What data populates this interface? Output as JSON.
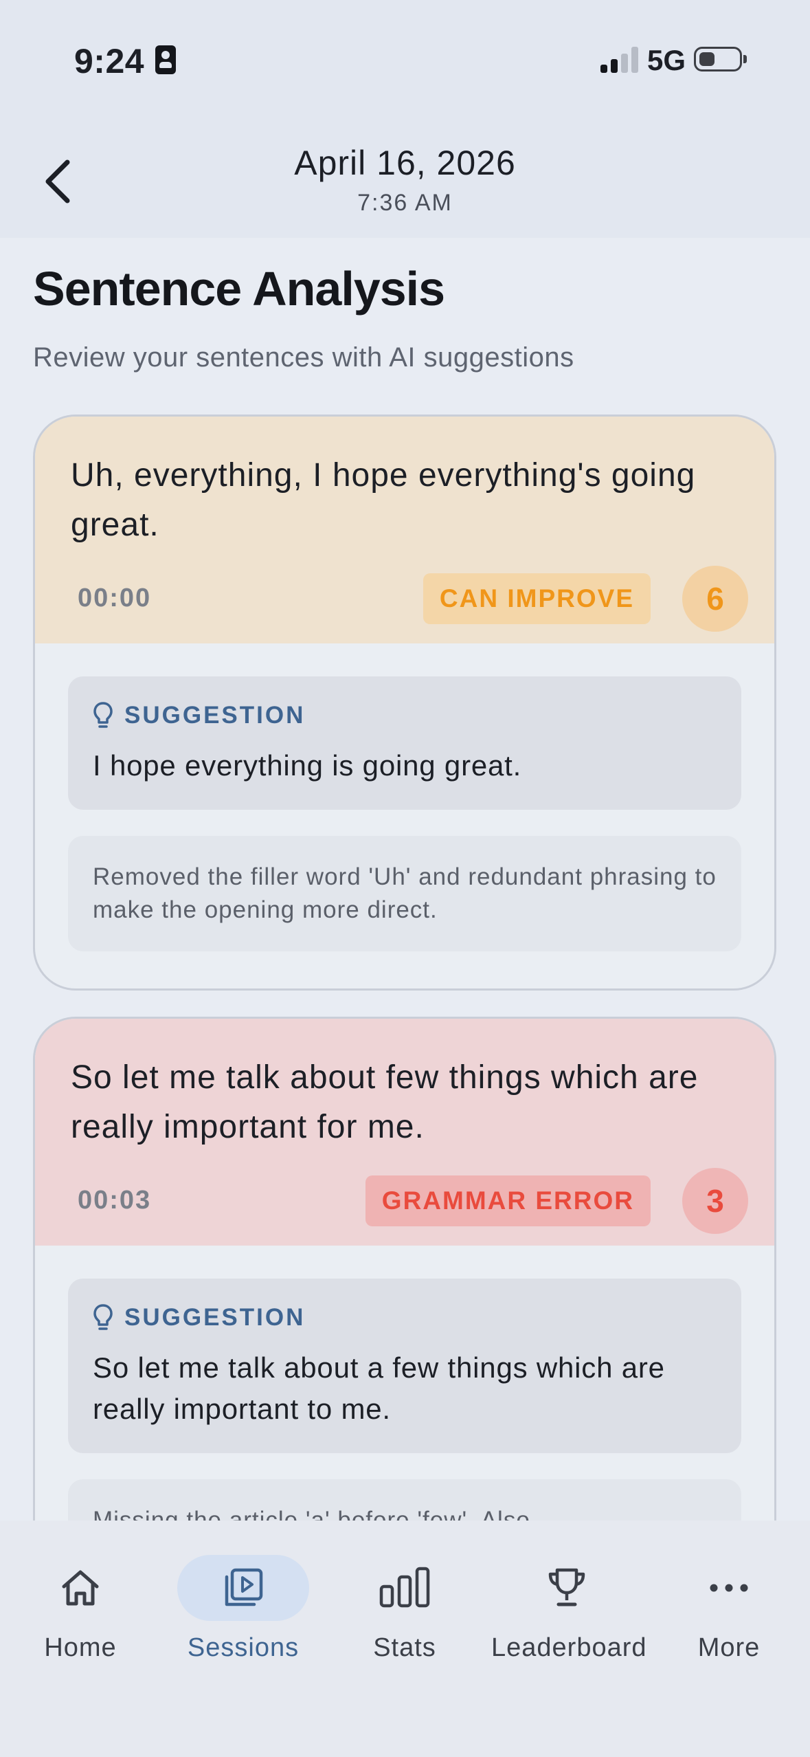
{
  "status_bar": {
    "time": "9:24",
    "network": "5G"
  },
  "header": {
    "date": "April 16, 2026",
    "time": "7:36 AM"
  },
  "page": {
    "title": "Sentence Analysis",
    "subtitle": "Review your sentences with AI suggestions"
  },
  "cards": [
    {
      "sentence": "Uh, everything, I hope everything's going great.",
      "timestamp": "00:00",
      "badge": "CAN IMPROVE",
      "score": "6",
      "suggestion_label": "SUGGESTION",
      "suggestion": "I hope everything is going great.",
      "explanation": "Removed the filler word 'Uh' and redundant phrasing to make the opening more direct."
    },
    {
      "sentence": "So let me talk about few things which are really important for me.",
      "timestamp": "00:03",
      "badge": "GRAMMAR ERROR",
      "score": "3",
      "suggestion_label": "SUGGESTION",
      "suggestion": "So let me talk about a few things which are really important to me.",
      "explanation": "Missing the article 'a' before 'few'. Also,"
    }
  ],
  "colors": {
    "improve": "#f0961a",
    "error": "#e94b3d",
    "accent": "#3e6491"
  },
  "nav": {
    "items": [
      {
        "label": "Home",
        "icon": "home-icon"
      },
      {
        "label": "Sessions",
        "icon": "sessions-icon"
      },
      {
        "label": "Stats",
        "icon": "stats-icon"
      },
      {
        "label": "Leaderboard",
        "icon": "trophy-icon"
      },
      {
        "label": "More",
        "icon": "more-icon"
      }
    ]
  }
}
